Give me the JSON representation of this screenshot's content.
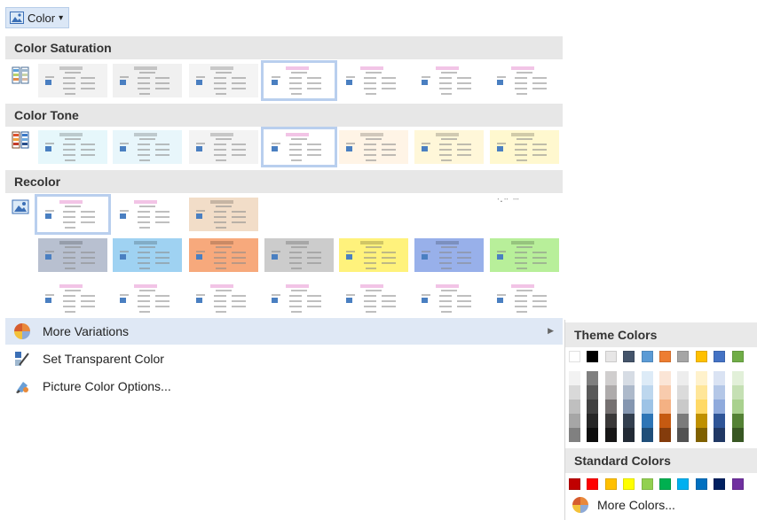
{
  "button": {
    "label": "Color",
    "arrow": "▾",
    "icon": "picture-icon"
  },
  "sections": {
    "saturation": {
      "title": "Color Saturation",
      "icon": "saturation-icon"
    },
    "tone": {
      "title": "Color Tone",
      "icon": "tone-icon"
    },
    "recolor": {
      "title": "Recolor",
      "icon": "recolor-picture-icon"
    }
  },
  "presets": {
    "saturation": [
      "#f2f2f2",
      "#f0f0f0",
      "#f4f4f4",
      "#ffffff",
      "#ffffff",
      "#ffffff",
      "#ffffff"
    ],
    "tone": [
      "#e6f7fb",
      "#e8f6fb",
      "#f3f3f3",
      "#ffffff",
      "#fff4e6",
      "#fff7d9",
      "#fff8cf"
    ],
    "recolor_row1": [
      "#ffffff",
      "#ffffff",
      "#f2ddc8"
    ],
    "recolor_row2": [
      "#b8c0d0",
      "#9fd2f2",
      "#f7a97c",
      "#cccccc",
      "#fff27c",
      "#98b0ea",
      "#b8ef9a"
    ],
    "recolor_row3": [
      "#ffffff",
      "#ffffff",
      "#ffffff",
      "#ffffff",
      "#ffffff",
      "#ffffff",
      "#ffffff"
    ]
  },
  "menu": {
    "more_variations": {
      "label": "More Variations",
      "icon": "palette-icon",
      "arrow": "▶"
    },
    "set_transparent": {
      "label": "Set Transparent Color",
      "icon": "transparent-pen-icon"
    },
    "picture_options": {
      "label": "Picture Color Options...",
      "icon": "picture-color-options-icon"
    }
  },
  "flyout": {
    "theme_title": "Theme Colors",
    "theme_top": [
      "#ffffff",
      "#000000",
      "#e7e6e6",
      "#44546a",
      "#5b9bd5",
      "#ed7d31",
      "#a5a5a5",
      "#ffc000",
      "#4472c4",
      "#70ad47"
    ],
    "theme_shades": [
      [
        "#f2f2f2",
        "#d9d9d9",
        "#bfbfbf",
        "#a6a6a6",
        "#808080"
      ],
      [
        "#7f7f7f",
        "#595959",
        "#404040",
        "#262626",
        "#0d0d0d"
      ],
      [
        "#d0cece",
        "#aeabab",
        "#757070",
        "#3a3838",
        "#171616"
      ],
      [
        "#d6dce4",
        "#adb9ca",
        "#8496b0",
        "#333f4f",
        "#222a35"
      ],
      [
        "#ddebf7",
        "#bdd7ee",
        "#9dc3e6",
        "#2e75b6",
        "#1f4e79"
      ],
      [
        "#fbe5d6",
        "#f8cbad",
        "#f4b183",
        "#c55a11",
        "#843c0c"
      ],
      [
        "#ededed",
        "#dbdbdb",
        "#c9c9c9",
        "#7b7b7b",
        "#525252"
      ],
      [
        "#fff2cc",
        "#ffe699",
        "#ffd966",
        "#bf9000",
        "#7f6000"
      ],
      [
        "#dae3f3",
        "#b4c7e7",
        "#8faadc",
        "#2f5597",
        "#203864"
      ],
      [
        "#e2f0d9",
        "#c5e0b4",
        "#a9d18e",
        "#548235",
        "#385723"
      ]
    ],
    "standard_title": "Standard Colors",
    "standard": [
      "#c00000",
      "#ff0000",
      "#ffc000",
      "#ffff00",
      "#92d050",
      "#00b050",
      "#00b0f0",
      "#0070c0",
      "#002060",
      "#7030a0"
    ],
    "more_colors": "More Colors..."
  }
}
